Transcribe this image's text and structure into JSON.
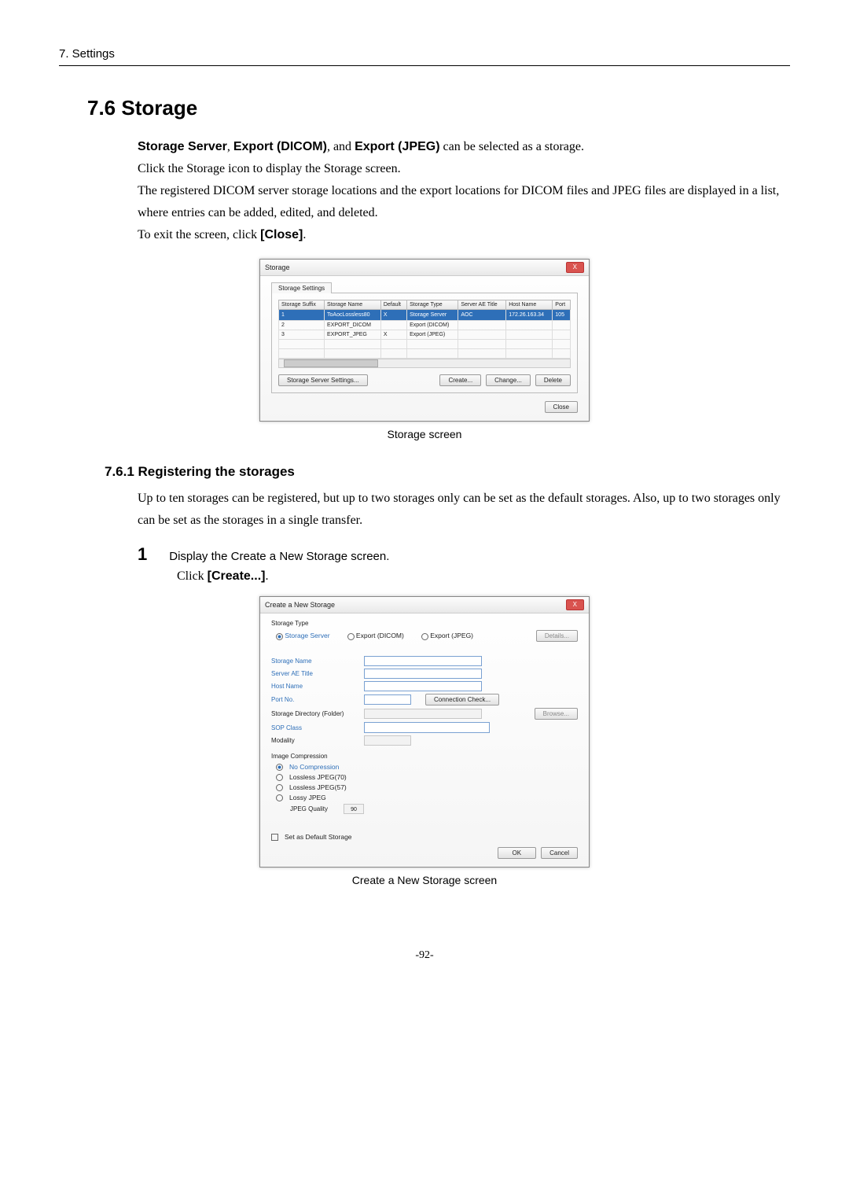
{
  "header": {
    "chapter": "7. Settings"
  },
  "section": {
    "number_title": "7.6 Storage"
  },
  "intro": {
    "line1_b1": "Storage Server",
    "line1_sep1": ", ",
    "line1_b2": "Export (DICOM)",
    "line1_mid": ", and ",
    "line1_b3": "Export (JPEG)",
    "line1_tail": " can be selected as a storage.",
    "line2": "Click the Storage icon to display the Storage screen.",
    "line3": "The registered DICOM server storage locations and the export locations for DICOM files and JPEG files are displayed in a list, where entries can be added, edited, and deleted.",
    "line4_pre": "To exit the screen, click ",
    "line4_btn": "[Close]",
    "line4_post": "."
  },
  "storage_dialog": {
    "title": "Storage",
    "tab": "Storage Settings",
    "close_x": "X",
    "columns": [
      "Storage Suffix",
      "Storage Name",
      "Default",
      "Storage Type",
      "Server AE Title",
      "Host Name",
      "Port"
    ],
    "rows": [
      {
        "suffix": "1",
        "name": "ToAocLossless80",
        "default": "X",
        "type": "Storage Server",
        "ae": "AOC",
        "host": "172.26.163.34",
        "port": "105",
        "sel": true
      },
      {
        "suffix": "2",
        "name": "EXPORT_DICOM",
        "default": "",
        "type": "Export (DICOM)",
        "ae": "",
        "host": "",
        "port": ""
      },
      {
        "suffix": "3",
        "name": "EXPORT_JPEG",
        "default": "X",
        "type": "Export (JPEG)",
        "ae": "",
        "host": "",
        "port": ""
      }
    ],
    "buttons": {
      "server_settings": "Storage Server Settings...",
      "create": "Create...",
      "change": "Change...",
      "delete": "Delete",
      "close": "Close"
    }
  },
  "caption1": "Storage screen",
  "subsection": {
    "title": "7.6.1 Registering the storages",
    "p1": "Up to ten storages can be registered, but up to two storages only can be set as the default storages. Also, up to two storages only can be set as the storages in a single transfer."
  },
  "step1": {
    "num": "1",
    "title": "Display the Create a New Storage screen.",
    "sub_pre": "Click ",
    "sub_btn": "[Create...]",
    "sub_post": "."
  },
  "create_dialog": {
    "title": "Create a New Storage",
    "close_x": "X",
    "type_label": "Storage Type",
    "type_options": {
      "server": "Storage Server",
      "dicom": "Export (DICOM)",
      "jpeg": "Export (JPEG)"
    },
    "details_btn": "Details...",
    "fields": {
      "storage_name": "Storage Name",
      "server_ae": "Server AE Title",
      "host_name": "Host Name",
      "port_no": "Port No.",
      "conn_check": "Connection Check...",
      "storage_dir": "Storage Directory (Folder)",
      "browse": "Browse...",
      "sop_class": "SOP Class",
      "modality": "Modality"
    },
    "compression": {
      "header": "Image Compression",
      "none": "No Compression",
      "ll70": "Lossless JPEG(70)",
      "ll57": "Lossless JPEG(57)",
      "lossy": "Lossy JPEG",
      "quality_label": "JPEG Quality",
      "quality_value": "90"
    },
    "default_chk": "Set as Default Storage",
    "ok": "OK",
    "cancel": "Cancel"
  },
  "caption2": "Create a New Storage screen",
  "page_number": "-92-"
}
